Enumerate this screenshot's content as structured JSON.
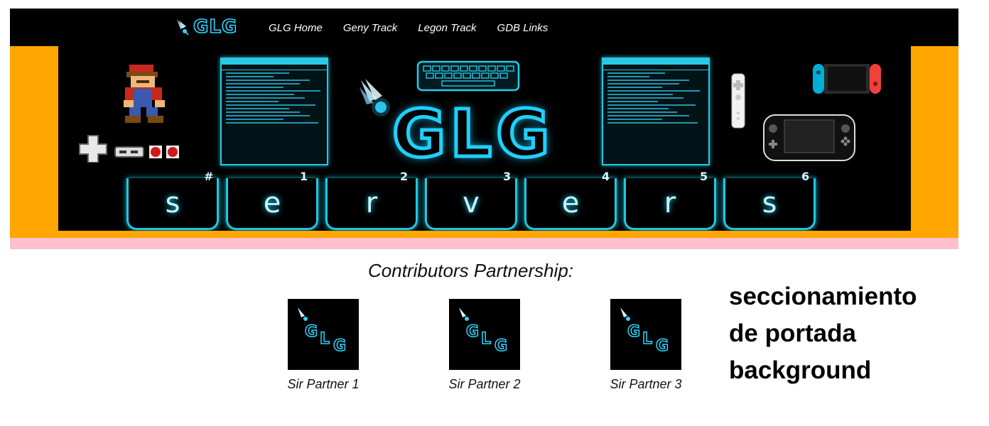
{
  "nav": {
    "logo_text": "GLG",
    "links": [
      {
        "label": "GLG Home"
      },
      {
        "label": "Geny Track"
      },
      {
        "label": "Legon Track"
      },
      {
        "label": "GDB Links"
      }
    ]
  },
  "banner": {
    "title": "GLG",
    "keys": [
      "s",
      "e",
      "r",
      "v",
      "e",
      "r",
      "s"
    ],
    "key_numbers": [
      "#",
      "1",
      "2",
      "3",
      "4",
      "5",
      "6"
    ]
  },
  "partners": {
    "heading": "Contributors Partnership:",
    "items": [
      {
        "name": "Sir Partner 1"
      },
      {
        "name": "Sir Partner 2"
      },
      {
        "name": "Sir Partner 3"
      }
    ]
  },
  "note": {
    "lines": [
      "seccionamiento",
      "de portada",
      "background"
    ]
  },
  "colors": {
    "nav_bg": "#000000",
    "banner_bg": "#000000",
    "accent_cyan": "#2fd3ff",
    "frame_orange": "#ffa500",
    "strip_pink": "#ffc0cb"
  }
}
